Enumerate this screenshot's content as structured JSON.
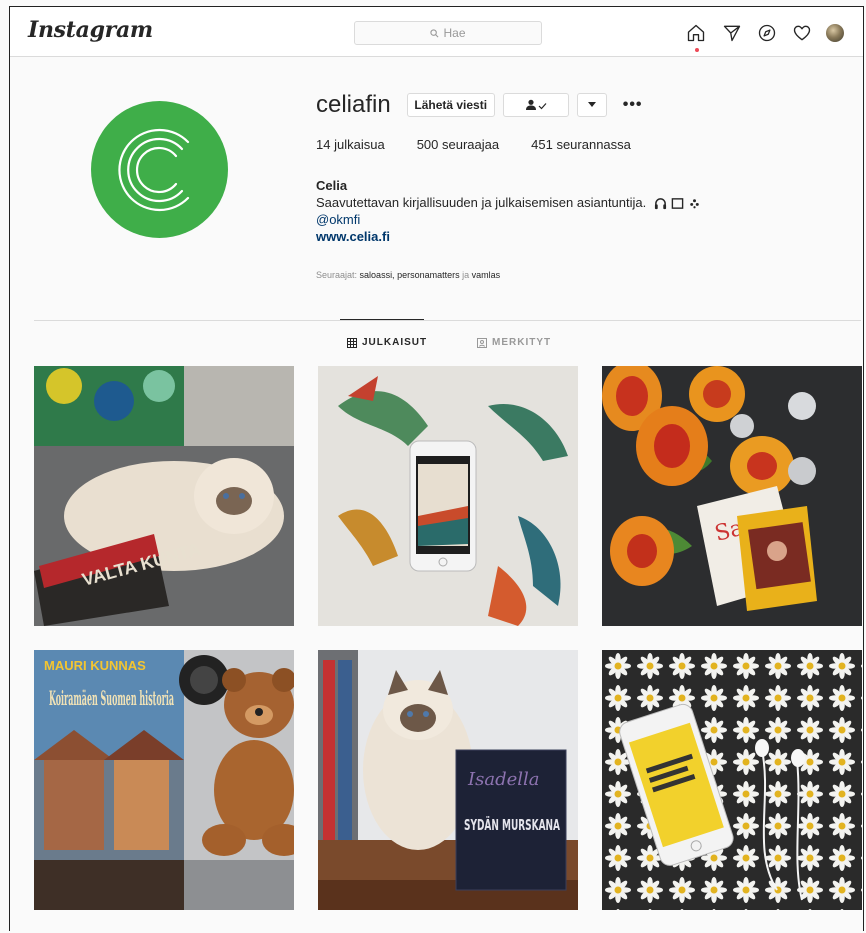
{
  "nav": {
    "logo": "Instagram",
    "search_placeholder": "Hae"
  },
  "profile": {
    "username": "celiafin",
    "message_button": "Lähetä viesti",
    "stats": {
      "posts_count": "14",
      "posts_label": "julkaisua",
      "followers_count": "500",
      "followers_label": "seuraajaa",
      "following_count": "451",
      "following_label": "seurannassa"
    },
    "name": "Celia",
    "bio": "Saavutettavan kirjallisuuden ja julkaisemisen asiantuntija.",
    "handle": "@okmfi",
    "website": "www.celia.fi",
    "followed_by_prefix": "Seuraajat:",
    "followed_by_names": "saloassi, personamatters",
    "followed_by_and": "ja",
    "followed_by_last": "vamlas"
  },
  "tabs": {
    "posts": "JULKAISUT",
    "tagged": "MERKITYT"
  },
  "posts": [
    {
      "book_title": "VALTA KUNTA"
    },
    {
      "book_title": ""
    },
    {
      "book_title": "Sapie"
    },
    {
      "book_title": "Koiramäen Suomen historia",
      "author": "MAURI KUNNAS"
    },
    {
      "book_title": "SYDÄN MURSKANA",
      "author": "Isadella"
    },
    {
      "book_title": ""
    }
  ],
  "colors": {
    "brand_green": "#3fae49",
    "link": "#00376b",
    "notification": "#ed4956"
  },
  "icons": [
    "search-icon",
    "home-icon",
    "direct-icon",
    "explore-icon",
    "heart-icon",
    "headphones-icon",
    "book-icon",
    "sparkle-icon",
    "grid-icon",
    "tagged-icon",
    "follow-person-icon"
  ]
}
